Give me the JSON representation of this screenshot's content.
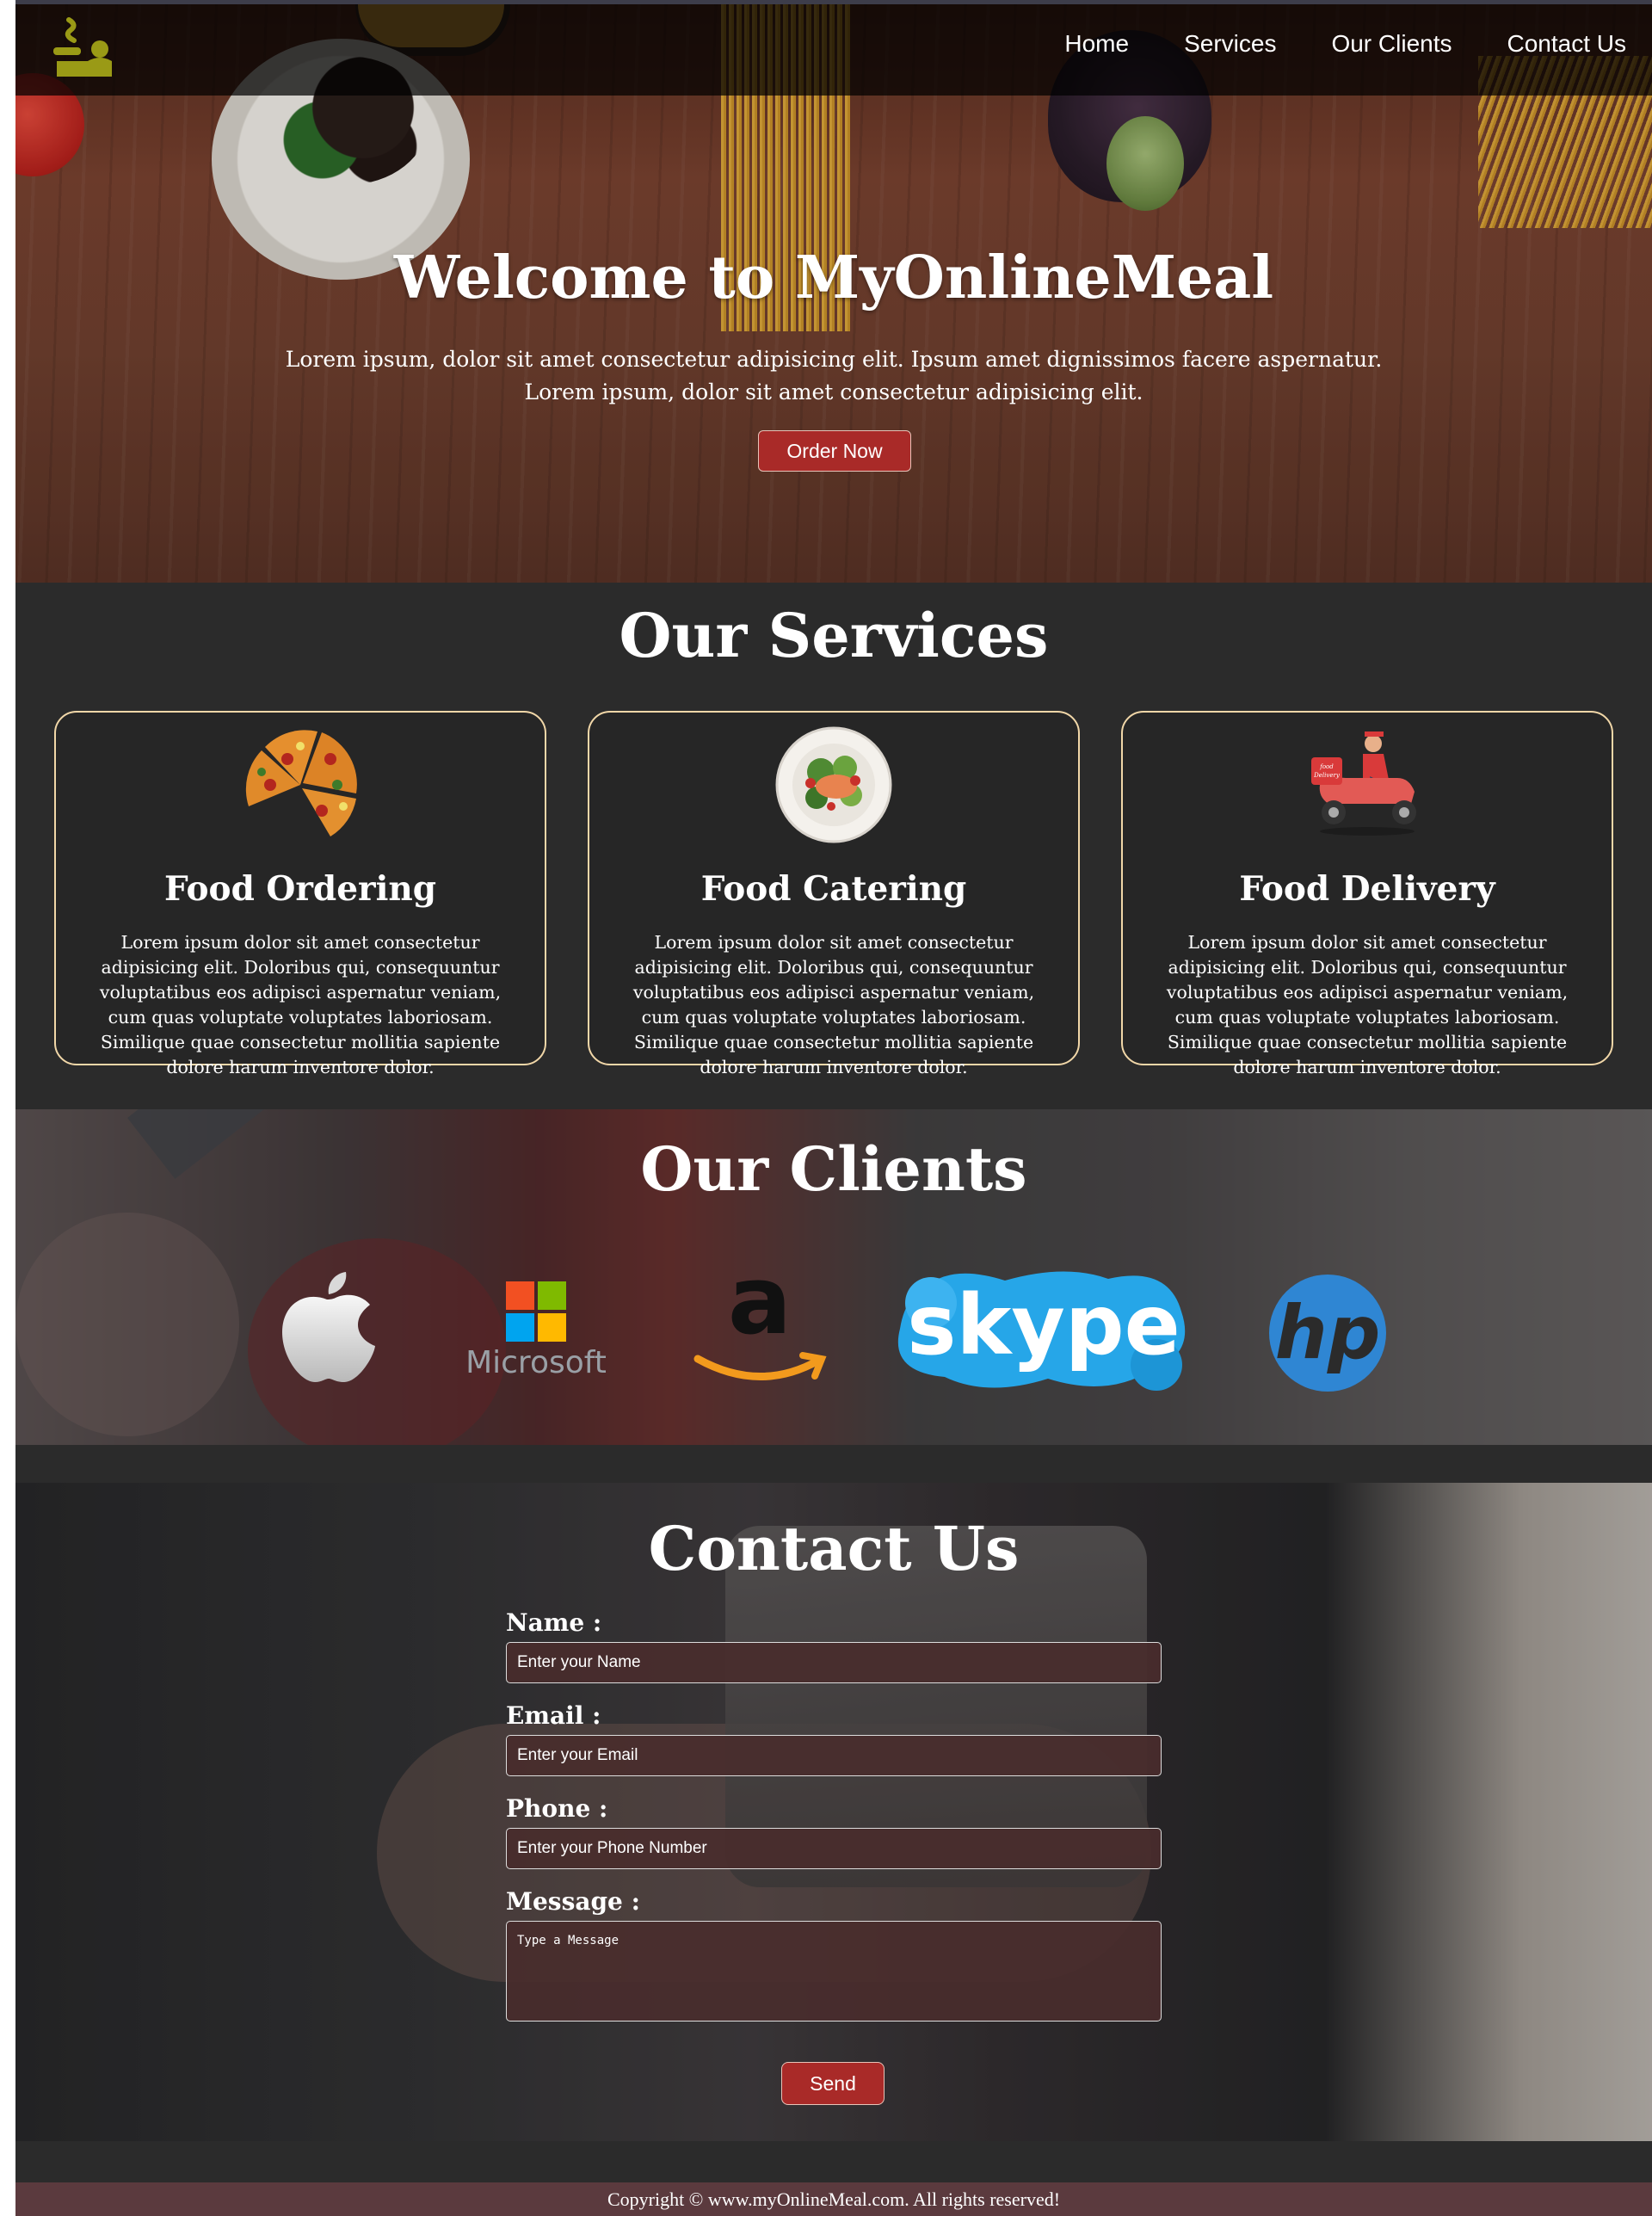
{
  "nav": {
    "items": [
      "Home",
      "Services",
      "Our Clients",
      "Contact Us"
    ]
  },
  "hero": {
    "title": "Welcome to MyOnlineMeal",
    "subtitle_line1": "Lorem ipsum, dolor sit amet consectetur adipisicing elit. Ipsum amet dignissimos facere aspernatur.",
    "subtitle_line2": "Lorem ipsum, dolor sit amet consectetur adipisicing elit.",
    "button": "Order Now"
  },
  "services": {
    "title": "Our Services",
    "cards": [
      {
        "title": "Food Ordering",
        "icon": "pizza-icon",
        "text": "Lorem ipsum dolor sit amet consectetur adipisicing elit. Doloribus qui, consequuntur voluptatibus eos adipisci aspernatur veniam, cum quas voluptate voluptates laboriosam. Similique quae consectetur mollitia sapiente dolore harum inventore dolor."
      },
      {
        "title": "Food Catering",
        "icon": "salad-plate-icon",
        "text": "Lorem ipsum dolor sit amet consectetur adipisicing elit. Doloribus qui, consequuntur voluptatibus eos adipisci aspernatur veniam, cum quas voluptate voluptates laboriosam. Similique quae consectetur mollitia sapiente dolore harum inventore dolor."
      },
      {
        "title": "Food Delivery",
        "icon": "delivery-scooter-icon",
        "badge_text": "food Delivery",
        "text": "Lorem ipsum dolor sit amet consectetur adipisicing elit. Doloribus qui, consequuntur voluptatibus eos adipisci aspernatur veniam, cum quas voluptate voluptates laboriosam. Similique quae consectetur mollitia sapiente dolore harum inventore dolor."
      }
    ]
  },
  "clients": {
    "title": "Our Clients",
    "logos": [
      "Apple",
      "Microsoft",
      "Amazon",
      "Skype",
      "HP"
    ],
    "microsoft_text": "Microsoft",
    "amazon_text": "a",
    "skype_text": "skype",
    "hp_text": "hp"
  },
  "contact": {
    "title": "Contact Us",
    "name_label": "Name :",
    "name_placeholder": "Enter your Name",
    "email_label": "Email :",
    "email_placeholder": "Enter your Email",
    "phone_label": "Phone :",
    "phone_placeholder": "Enter your Phone Number",
    "message_label": "Message :",
    "message_placeholder": "Type a Message",
    "send": "Send"
  },
  "footer": {
    "text": "Copyright © www.myOnlineMeal.com. All rights reserved!"
  },
  "colors": {
    "button_red": "#a92a28",
    "page_dark": "#2b2b2b",
    "card_border": "#f1d7a8",
    "footer_bg": "#5b3a3e",
    "logo_olive": "#9a9a16"
  }
}
